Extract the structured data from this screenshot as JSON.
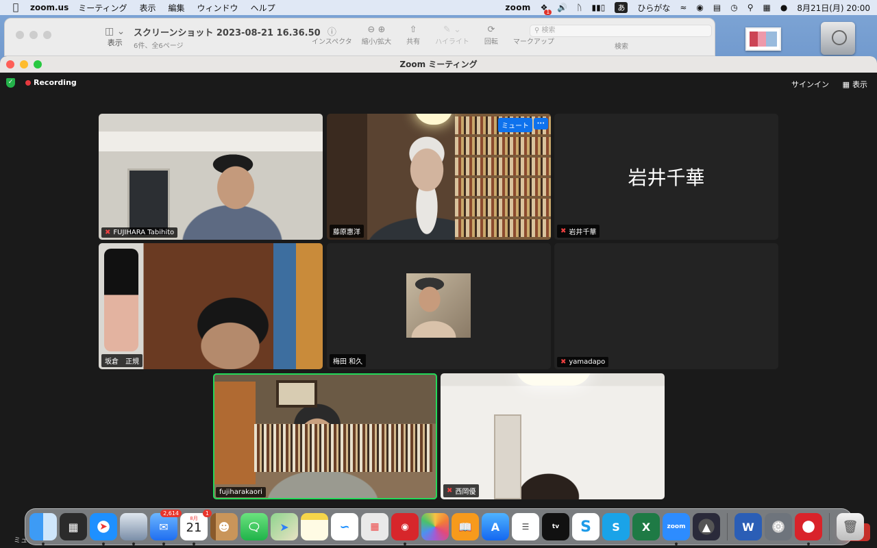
{
  "menubar": {
    "app_name": "zoom.us",
    "menus": [
      "ミーティング",
      "表示",
      "編集",
      "ウィンドウ",
      "ヘルプ"
    ],
    "zoom_label": "zoom",
    "zoom_badge": "1",
    "ime_indicator": "あ",
    "ime_label": "ひらがな",
    "datetime": "8月21日(月)  20:00"
  },
  "preview": {
    "sidebar_label": "表示",
    "title": "スクリーンショット 2023-08-21 16.36.50",
    "subtitle": "6件、全6ページ",
    "tools": [
      {
        "icon": "info-icon",
        "label": "インスペクタ"
      },
      {
        "icon": "zoom-icon",
        "label": "縮小/拡大"
      },
      {
        "icon": "share-icon",
        "label": "共有"
      },
      {
        "icon": "highlight-icon",
        "label": "ハイライト"
      },
      {
        "icon": "rotate-icon",
        "label": "回転"
      },
      {
        "icon": "markup-icon",
        "label": "マークアップ"
      }
    ],
    "search_placeholder": "検索",
    "search_label": "検索"
  },
  "zoom_window": {
    "title": "Zoom ミーティング",
    "recording_label": "Recording",
    "signin_label": "サインイン",
    "view_label": "表示",
    "participant_menu": {
      "mute_label": "ミュート",
      "more_label": "···"
    },
    "participants": [
      {
        "name": "FUJIHARA Tabihito",
        "muted": true
      },
      {
        "name": "藤原惠洋",
        "muted": false
      },
      {
        "name": "岩井千華",
        "muted": true,
        "video_off": true
      },
      {
        "name": "坂倉　正規",
        "muted": false
      },
      {
        "name": "梅田 和久",
        "muted": false,
        "video_off": true
      },
      {
        "name": "yamadapo",
        "muted": true,
        "video_off": true
      },
      {
        "name": "fujiharakaori",
        "muted": false,
        "active_speaker": true
      },
      {
        "name": "西岡優",
        "muted": true
      }
    ],
    "bottom_left_label": "ミュ",
    "leave_label": "出"
  },
  "dock": {
    "items": [
      {
        "name": "finder",
        "label": "",
        "color": "#2d8cf0"
      },
      {
        "name": "mission-control",
        "label": "",
        "color": "#333"
      },
      {
        "name": "safari",
        "label": "",
        "color": "#1e90ff"
      },
      {
        "name": "preview",
        "label": "",
        "color": "#5b6f8a"
      },
      {
        "name": "mail",
        "label": "",
        "badge": "2,614",
        "color": "#3a8ef5"
      },
      {
        "name": "calendar",
        "month": "8月",
        "day": "21",
        "badge": "1",
        "color": "#ffffff"
      },
      {
        "name": "contacts",
        "label": "",
        "color": "#b07a3e"
      },
      {
        "name": "messages",
        "label": "",
        "color": "#33c759"
      },
      {
        "name": "maps",
        "label": "",
        "color": "#5ec26a"
      },
      {
        "name": "notes",
        "label": "",
        "color": "#f5d54a"
      },
      {
        "name": "freeform",
        "label": "",
        "color": "#ffffff"
      },
      {
        "name": "launchpad",
        "label": "",
        "color": "#e8e8e8"
      },
      {
        "name": "photo-booth",
        "label": "",
        "color": "#d7262b"
      },
      {
        "name": "photos",
        "label": "",
        "color": "#f2f2f2"
      },
      {
        "name": "books",
        "label": "",
        "color": "#f79a1c"
      },
      {
        "name": "app-store",
        "label": "",
        "color": "#1c8cf5"
      },
      {
        "name": "reminders",
        "label": "",
        "color": "#ffffff"
      },
      {
        "name": "apple-tv",
        "label": "tv",
        "color": "#111111"
      },
      {
        "name": "skype-1",
        "label": "S",
        "color": "#1e9be8"
      },
      {
        "name": "skype-2",
        "label": "S",
        "color": "#1aa3e8"
      },
      {
        "name": "excel",
        "label": "X",
        "color": "#1e7a45"
      },
      {
        "name": "zoom",
        "label": "zoom",
        "color": "#2d8cff"
      },
      {
        "name": "prism",
        "label": "",
        "color": "#3a3a4a"
      },
      {
        "name": "word",
        "label": "W",
        "color": "#2b5eb6"
      },
      {
        "name": "system-settings",
        "label": "",
        "color": "#8a8f96"
      },
      {
        "name": "security-app",
        "label": "",
        "color": "#d9232a"
      },
      {
        "name": "trash",
        "label": "",
        "color": "#dcdcdc"
      }
    ]
  }
}
